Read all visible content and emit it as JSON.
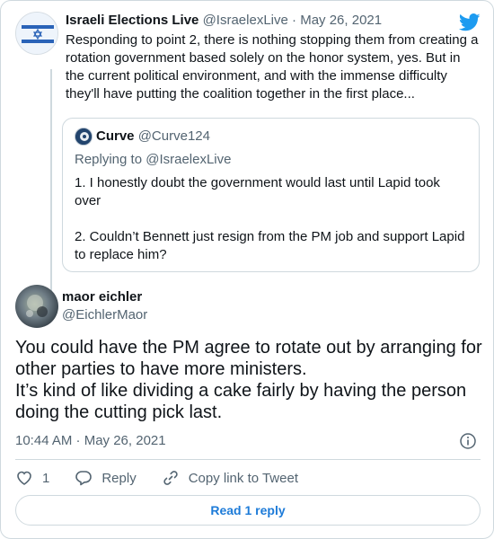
{
  "parent": {
    "display_name": "Israeli Elections Live",
    "handle": "@IsraelexLive",
    "separator": "·",
    "date": "May 26, 2021",
    "text": "Responding to point 2, there is nothing stopping them from creating a rotation government based solely on the honor system, yes. But in the current political environment, and with the immense difficulty they'll have putting the coalition together in the first place..."
  },
  "quote": {
    "display_name": "Curve",
    "handle": "@Curve124",
    "replying_to": "Replying to @IsraelexLive",
    "text": "1. I honestly doubt the government would last until Lapid took over\n\n2. Couldn’t Bennett just resign from the PM job and support Lapid to replace him?"
  },
  "main": {
    "display_name": "maor eichler",
    "handle": "@EichlerMaor",
    "text": "You could have the PM agree to rotate out by arranging for other parties to have more ministers.\nIt’s kind of like dividing a cake fairly by having the person doing the cutting pick last.",
    "timestamp": "10:44 AM · May 26, 2021"
  },
  "actions": {
    "like_count": "1",
    "reply_label": "Reply",
    "copy_link_label": "Copy link to Tweet"
  },
  "read_replies_label": "Read 1 reply",
  "colors": {
    "brand_blue": "#1d9bf0",
    "text": "#0f1419",
    "muted": "#536471",
    "border": "#cfd9de"
  },
  "icons": [
    "twitter-logo-icon",
    "heart-icon",
    "reply-icon",
    "link-icon",
    "info-icon"
  ]
}
